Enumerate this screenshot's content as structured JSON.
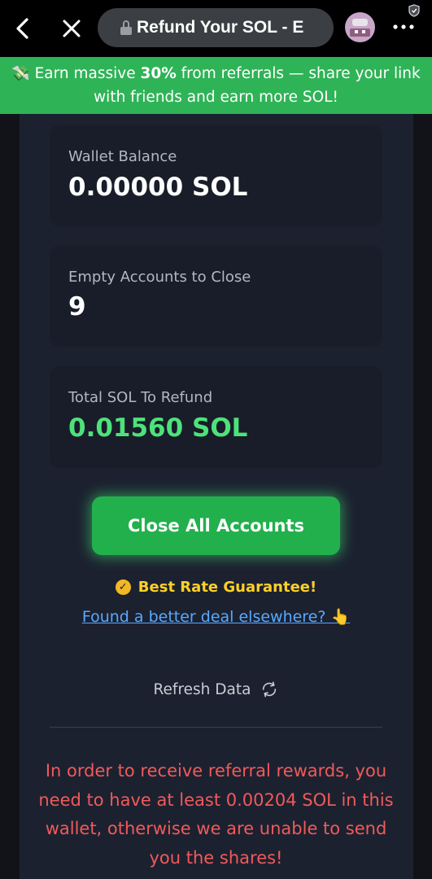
{
  "browser": {
    "back_icon": "chevron-left-icon",
    "close_icon": "close-icon",
    "lock_icon": "lock-icon",
    "tab_title": "Refund Your SOL - E",
    "more_icon": "more-horizontal-icon"
  },
  "banner": {
    "emoji": "💸",
    "text_before": "Earn massive ",
    "highlight": "30%",
    "text_after": " from referrals — share your link with friends and earn more SOL!",
    "color": "#2fb357"
  },
  "stats": {
    "wallet_balance_label": "Wallet Balance",
    "wallet_balance_value": "0.00000 SOL",
    "empty_accounts_label": "Empty Accounts to Close",
    "empty_accounts_value": "9",
    "total_refund_label": "Total SOL To Refund",
    "total_refund_value": "0.01560 SOL"
  },
  "actions": {
    "close_all_label": "Close All Accounts",
    "guarantee_text": "Best Rate Guarantee!",
    "deal_link_text": "Found a better deal elsewhere? 👆",
    "refresh_label": "Refresh Data",
    "refresh_icon": "refresh-icon"
  },
  "warning": {
    "text": "In order to receive referral rewards, you need to have at least 0.00204 SOL in this wallet, otherwise we are unable to send you the shares!"
  },
  "colors": {
    "accent_green": "#22b04d",
    "value_green": "#4ee27a",
    "gold": "#ffd027",
    "link": "#58a9ff",
    "warning": "#f05a5a"
  }
}
